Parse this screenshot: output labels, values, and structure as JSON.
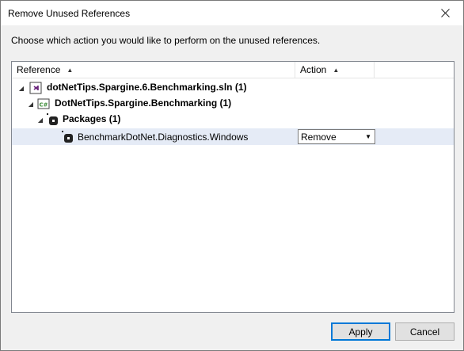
{
  "window": {
    "title": "Remove Unused References",
    "close_icon": "close-icon"
  },
  "instruction": "Choose which action you would like to perform on the unused references.",
  "table": {
    "columns": [
      {
        "label": "Reference",
        "sort": "ascending"
      },
      {
        "label": "Action",
        "sort": "ascending"
      },
      {
        "label": ""
      }
    ],
    "rows": [
      {
        "label": "dotNetTips.Spargine.6.Benchmarking.sln (1)",
        "icon": "solution-icon",
        "expanded": true,
        "bold": true
      },
      {
        "label": "DotNetTips.Spargine.Benchmarking (1)",
        "icon": "csharp-project-icon",
        "expanded": true,
        "bold": true
      },
      {
        "label": "Packages (1)",
        "icon": "package-icon",
        "expanded": true,
        "bold": true
      },
      {
        "label": "BenchmarkDotNet.Diagnostics.Windows",
        "icon": "package-icon",
        "action": "Remove",
        "bold": false
      }
    ]
  },
  "buttons": {
    "apply": "Apply",
    "cancel": "Cancel"
  },
  "colors": {
    "accent": "#0078d7",
    "selection": "#e5ebf6",
    "solution_icon": "#68217a",
    "csharp_icon": "#388a34"
  }
}
